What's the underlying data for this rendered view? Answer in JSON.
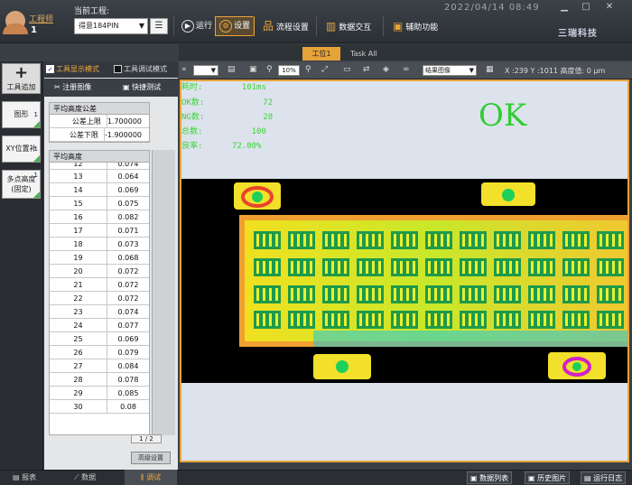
{
  "user": {
    "role": "工程师",
    "id": "1"
  },
  "project": {
    "label": "当前工程:",
    "value": "得意184PIN"
  },
  "toolbar": {
    "run": "运行",
    "settings": "设置",
    "flow": "流程设置",
    "data_exchange": "数据交互",
    "aux": "辅助功能"
  },
  "datetime": "2022/04/14  08:49",
  "brand": "三瑞科技",
  "tabs": {
    "station": "工位1",
    "all": "Task All"
  },
  "sidebar": {
    "add_tool": "工具追加",
    "items": [
      {
        "label": "图形",
        "no": "1"
      },
      {
        "label": "XY位置补正",
        "no": "1"
      },
      {
        "label": "多点高度(固定)",
        "no": "1"
      }
    ]
  },
  "panel": {
    "mode_display": "工具显示模式",
    "mode_debug": "工具调试模式",
    "register_image": "注册图像",
    "quick_test": "快捷测试",
    "tolerance": {
      "title": "平均高度公差",
      "rows": [
        {
          "label": "公差上限",
          "value": "1.700000"
        },
        {
          "label": "公差下限",
          "value": "-1.900000"
        }
      ]
    },
    "avg_height": {
      "title": "平均高度",
      "rows": [
        {
          "idx": "12",
          "value": "0.074"
        },
        {
          "idx": "13",
          "value": "0.064"
        },
        {
          "idx": "14",
          "value": "0.069"
        },
        {
          "idx": "15",
          "value": "0.075"
        },
        {
          "idx": "16",
          "value": "0.082"
        },
        {
          "idx": "17",
          "value": "0.071"
        },
        {
          "idx": "18",
          "value": "0.073"
        },
        {
          "idx": "19",
          "value": "0.068"
        },
        {
          "idx": "20",
          "value": "0.072"
        },
        {
          "idx": "21",
          "value": "0.072"
        },
        {
          "idx": "22",
          "value": "0.072"
        },
        {
          "idx": "23",
          "value": "0.074"
        },
        {
          "idx": "24",
          "value": "0.077"
        },
        {
          "idx": "25",
          "value": "0.069"
        },
        {
          "idx": "26",
          "value": "0.079"
        },
        {
          "idx": "27",
          "value": "0.084"
        },
        {
          "idx": "28",
          "value": "0.078"
        },
        {
          "idx": "29",
          "value": "0.085"
        },
        {
          "idx": "30",
          "value": "0.08"
        }
      ]
    },
    "pager": "1 / 2",
    "advanced": "高级设置"
  },
  "viewer": {
    "zoom": "10%",
    "combo": "",
    "result_select": "结果图像",
    "coord": "X :239 Y :1011 高度值: 0 µm",
    "stats": [
      {
        "label": "耗时:",
        "value": "101ms"
      },
      {
        "label": "OK数:",
        "value": "72"
      },
      {
        "label": "NG数:",
        "value": "28"
      },
      {
        "label": "总数:",
        "value": "100"
      },
      {
        "label": "良率:",
        "value": "72.00%"
      }
    ],
    "verdict": "OK"
  },
  "bottom": {
    "report": "报表",
    "data": "数据",
    "debug": "调试",
    "data_list": "数据列表",
    "history": "历史图片",
    "run_log": "运行日志"
  }
}
